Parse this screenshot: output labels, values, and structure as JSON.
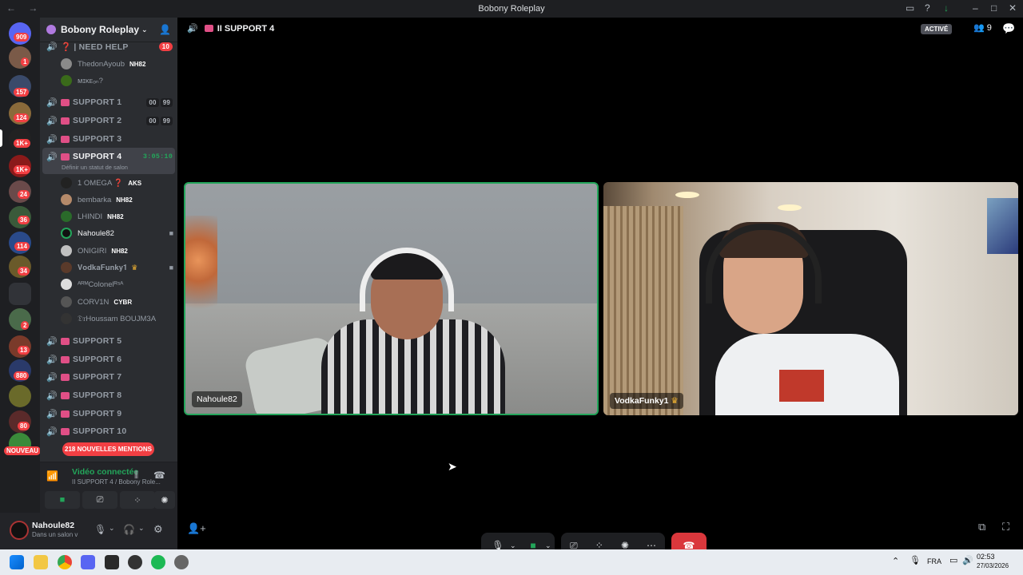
{
  "window": {
    "title": "Bobony Roleplay"
  },
  "serverbar": {
    "badges": [
      "909",
      "1",
      "157",
      "124",
      "1K+",
      "1K+",
      "24",
      "36",
      "114",
      "34",
      "2",
      "13",
      "880",
      "80"
    ],
    "new_label": "NOUVEAU"
  },
  "sidebar": {
    "server_name": "Bobony Roleplay",
    "need_help": {
      "label": "❓ | NEED HELP",
      "count": "10"
    },
    "need_help_members": [
      {
        "name": "ThedonAyoub",
        "role": "NH82"
      },
      {
        "name": "ᴍɪᴋᴇₒₙ?",
        "role": ""
      }
    ],
    "support_1": {
      "label": "SUPPORT 1",
      "a": "00",
      "b": "99"
    },
    "support_2": {
      "label": "SUPPORT 2",
      "a": "00",
      "b": "99"
    },
    "support_3": {
      "label": "SUPPORT 3"
    },
    "support_4": {
      "label": "SUPPORT 4",
      "timer": "3:05:10",
      "status": "Définir un statut de salon"
    },
    "members": [
      {
        "name": "1 ΟΜΕGΑ ❓",
        "role": "AKS"
      },
      {
        "name": "bembarka",
        "role": "NH82"
      },
      {
        "name": "LHINDI",
        "role": "NH82"
      },
      {
        "name": "Nahoule82",
        "role": ""
      },
      {
        "name": "ONIGIRI",
        "role": "NH82"
      },
      {
        "name": "𝐕𝐨𝐝𝐤𝐚𝐅𝐮𝐧𝐤𝐲𝟏",
        "role": ""
      },
      {
        "name": "ᴬᴿᴹColonelᴿˢᴬ",
        "role": ""
      },
      {
        "name": "CORV1N",
        "role": "CYBR"
      },
      {
        "name": "𝔇𝔯Houssam BOUJM3A",
        "role": ""
      }
    ],
    "support_rest": [
      "SUPPORT 5",
      "SUPPORT 6",
      "SUPPORT 7",
      "SUPPORT 8",
      "SUPPORT 9",
      "SUPPORT 10"
    ],
    "mentions": "218 NOUVELLES MENTIONS"
  },
  "voice_panel": {
    "status": "Vidéo connectée",
    "location": "II SUPPORT 4 / Bobony Role..."
  },
  "user_panel": {
    "username": "Nahoule82",
    "status": "Dans un salon v"
  },
  "channel_header": {
    "title": "II SUPPORT 4",
    "activity": "ACTIVÉ",
    "participants": "9"
  },
  "tiles": [
    {
      "name": "Nahoule82"
    },
    {
      "name": "VodkaFunky1"
    }
  ],
  "taskbar": {
    "lang": "FRA",
    "time": "02:53",
    "date": "27/03/2026"
  }
}
